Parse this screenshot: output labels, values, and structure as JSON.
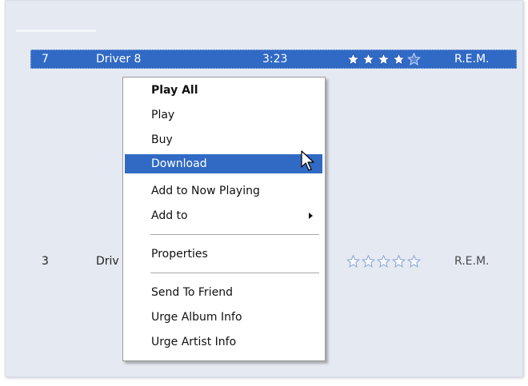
{
  "tracklist": {
    "selected_row": {
      "number": "7",
      "title": "Driver 8",
      "length": "3:23",
      "rating": 4,
      "artist": "R.E.M."
    },
    "second_row": {
      "number": "3",
      "title": "Driv",
      "rating": 0,
      "artist": "R.E.M."
    }
  },
  "context_menu": {
    "items": [
      {
        "label": "Play All",
        "default": true
      },
      {
        "label": "Play"
      },
      {
        "label": "Buy"
      },
      {
        "label": "Download",
        "highlighted": true
      },
      {
        "label": "Add to Now Playing"
      },
      {
        "label": "Add to",
        "has_submenu": true
      },
      {
        "label": "Properties"
      },
      {
        "label": "Send To Friend"
      },
      {
        "label": "Urge Album Info"
      },
      {
        "label": "Urge Artist Info"
      }
    ]
  },
  "colors": {
    "selection": "#316ac5",
    "pane_background": "#e5e9f1"
  },
  "icons": {
    "filled_star": "star-filled-icon",
    "empty_star": "star-empty-icon",
    "submenu": "chevron-right-icon",
    "pointer": "mouse-cursor-icon"
  }
}
